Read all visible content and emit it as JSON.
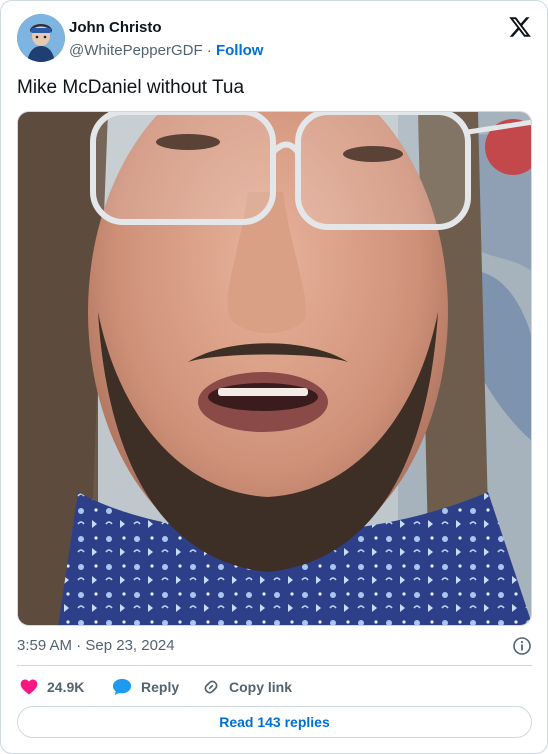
{
  "author": {
    "name": "John Christo",
    "handle": "@WhitePepperGDF",
    "separator": "·",
    "follow_label": "Follow"
  },
  "tweet": {
    "text": "Mike McDaniel without Tua",
    "timestamp": "3:59 AM · Sep 23, 2024"
  },
  "actions": {
    "likes": "24.9K",
    "reply_label": "Reply",
    "copy_link_label": "Copy link",
    "read_replies_label": "Read 143 replies"
  },
  "colors": {
    "like": "#f91880",
    "reply": "#1d9bf0",
    "link": "#006fd6",
    "muted": "#536471",
    "border": "#cfd9de"
  },
  "icons": [
    "x-logo-icon",
    "info-icon",
    "heart-icon",
    "reply-bubble-icon",
    "link-icon"
  ]
}
